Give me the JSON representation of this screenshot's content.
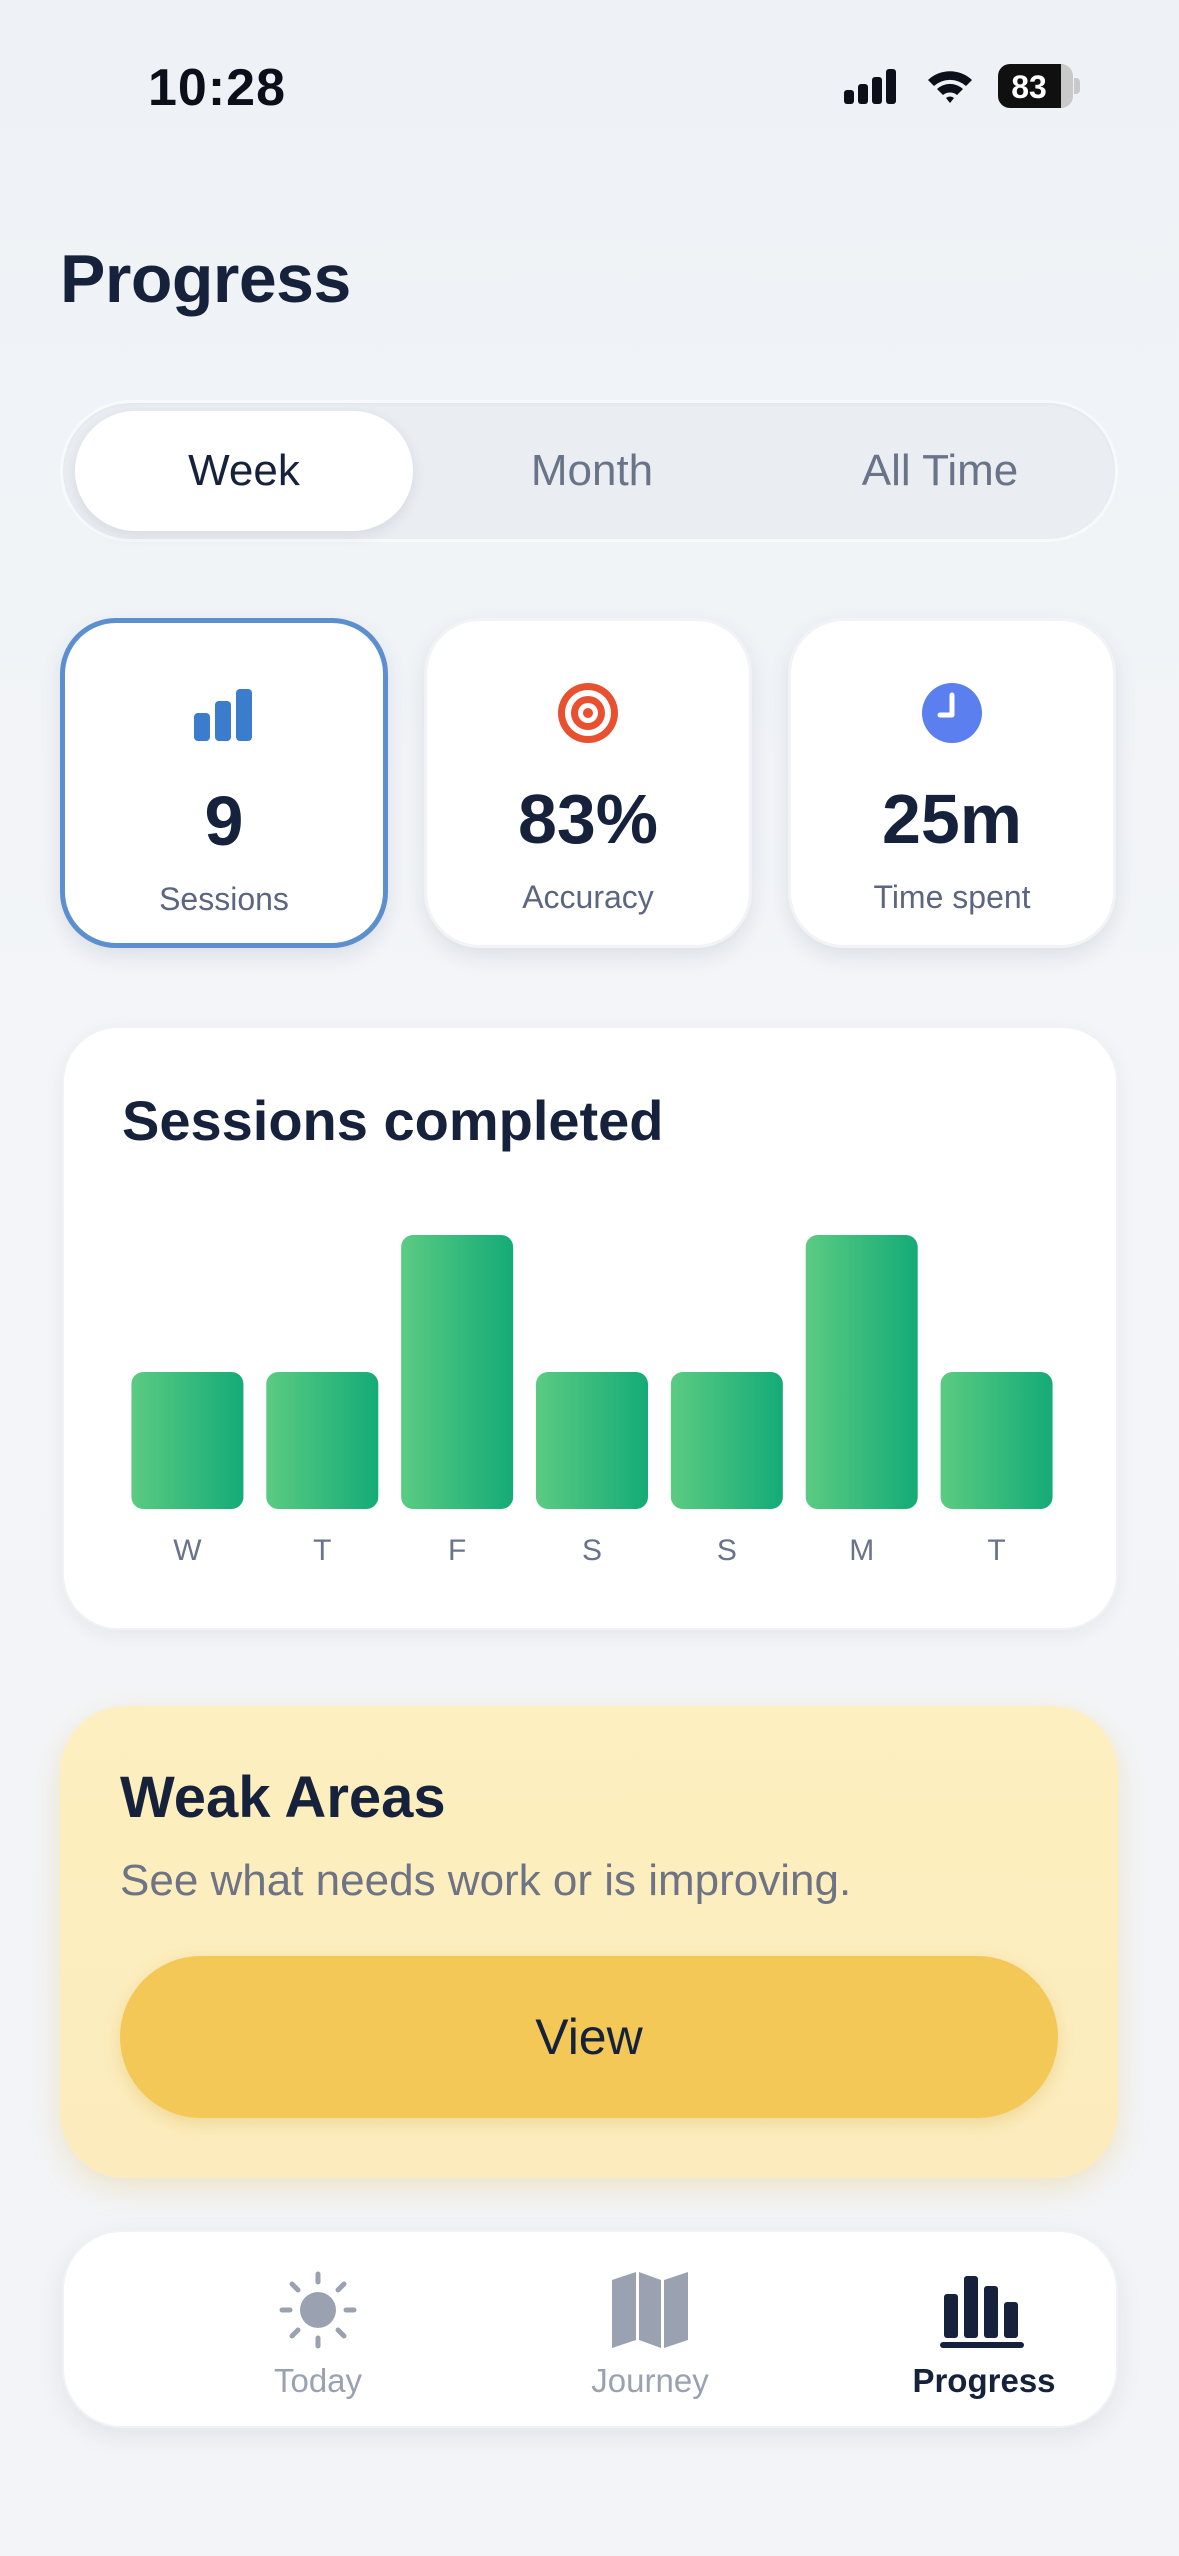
{
  "status_bar": {
    "time": "10:28",
    "battery": "83"
  },
  "page": {
    "title": "Progress"
  },
  "period_tabs": [
    {
      "label": "Week",
      "active": true
    },
    {
      "label": "Month",
      "active": false
    },
    {
      "label": "All Time",
      "active": false
    }
  ],
  "stats": [
    {
      "icon": "bar-chart-icon",
      "value": "9",
      "label": "Sessions",
      "selected": true,
      "color": "#3b7ccc"
    },
    {
      "icon": "target-icon",
      "value": "83%",
      "label": "Accuracy",
      "selected": false,
      "color": "#e8502f"
    },
    {
      "icon": "clock-icon",
      "value": "25m",
      "label": "Time spent",
      "selected": false,
      "color": "#5b7fef"
    }
  ],
  "sessions_chart": {
    "title": "Sessions completed"
  },
  "chart_data": {
    "type": "bar",
    "categories": [
      "W",
      "T",
      "F",
      "S",
      "S",
      "M",
      "T"
    ],
    "values": [
      1,
      1,
      2,
      1,
      1,
      2,
      1
    ],
    "title": "Sessions completed",
    "xlabel": "",
    "ylabel": "",
    "ylim": [
      0,
      2
    ],
    "grid": false,
    "bar_color_start": "#5bcb82",
    "bar_color_end": "#14ab77"
  },
  "weak_areas": {
    "title": "Weak Areas",
    "subtitle": "See what needs work or is improving.",
    "button_label": "View"
  },
  "tab_bar": [
    {
      "icon": "sun-icon",
      "label": "Today",
      "active": false
    },
    {
      "icon": "map-icon",
      "label": "Journey",
      "active": false
    },
    {
      "icon": "bar-chart-icon",
      "label": "Progress",
      "active": true
    }
  ],
  "colors": {
    "accent_blue": "#5b8fd0",
    "weak_bg": "#fdefbf",
    "view_button": "#f3c857",
    "text_dark": "#16213b"
  }
}
